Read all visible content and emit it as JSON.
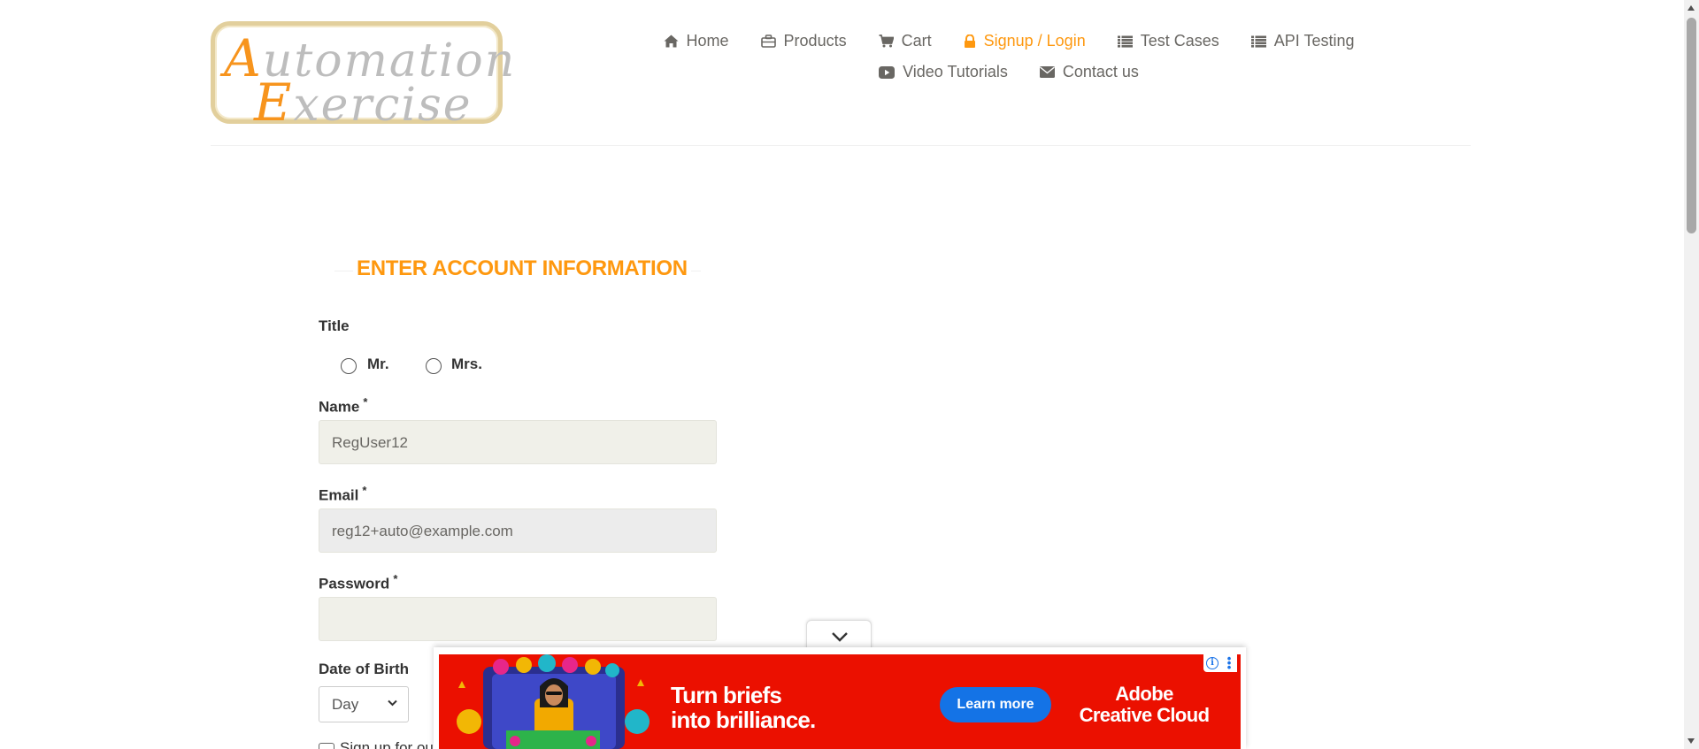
{
  "logo": {
    "line1_cap": "A",
    "line1_rest": "utomation",
    "line2_cap": "E",
    "line2_rest": "xercise"
  },
  "nav": {
    "items": [
      {
        "label": "Home",
        "icon": "home-icon",
        "active": false
      },
      {
        "label": "Products",
        "icon": "briefcase-icon",
        "active": false
      },
      {
        "label": "Cart",
        "icon": "cart-icon",
        "active": false
      },
      {
        "label": "Signup / Login",
        "icon": "lock-icon",
        "active": true
      },
      {
        "label": "Test Cases",
        "icon": "list-icon",
        "active": false
      },
      {
        "label": "API Testing",
        "icon": "list-icon",
        "active": false
      },
      {
        "label": "Video Tutorials",
        "icon": "youtube-play-icon",
        "active": false
      },
      {
        "label": "Contact us",
        "icon": "envelope-icon",
        "active": false
      }
    ]
  },
  "form": {
    "heading": "ENTER ACCOUNT INFORMATION",
    "title_label": "Title",
    "title_options": [
      "Mr.",
      "Mrs."
    ],
    "name_label": "Name",
    "name_value": "RegUser12",
    "email_label": "Email",
    "email_value": "reg12+auto@example.com",
    "password_label": "Password",
    "password_value": "",
    "required_mark": "*",
    "dob_label": "Date of Birth",
    "dob_day_value": "Day",
    "newsletter_label": "Sign up for our newsletter!"
  },
  "ad": {
    "headline_line1": "Turn briefs",
    "headline_line2": "into brilliance.",
    "cta": "Learn more",
    "brand_line1": "Adobe",
    "brand_line2": "Creative Cloud",
    "info_icon": "i",
    "colors": {
      "background": "#eb1000",
      "cta": "#1473e6"
    }
  },
  "colors": {
    "accent": "#fe980f",
    "nav_text": "#696763"
  }
}
